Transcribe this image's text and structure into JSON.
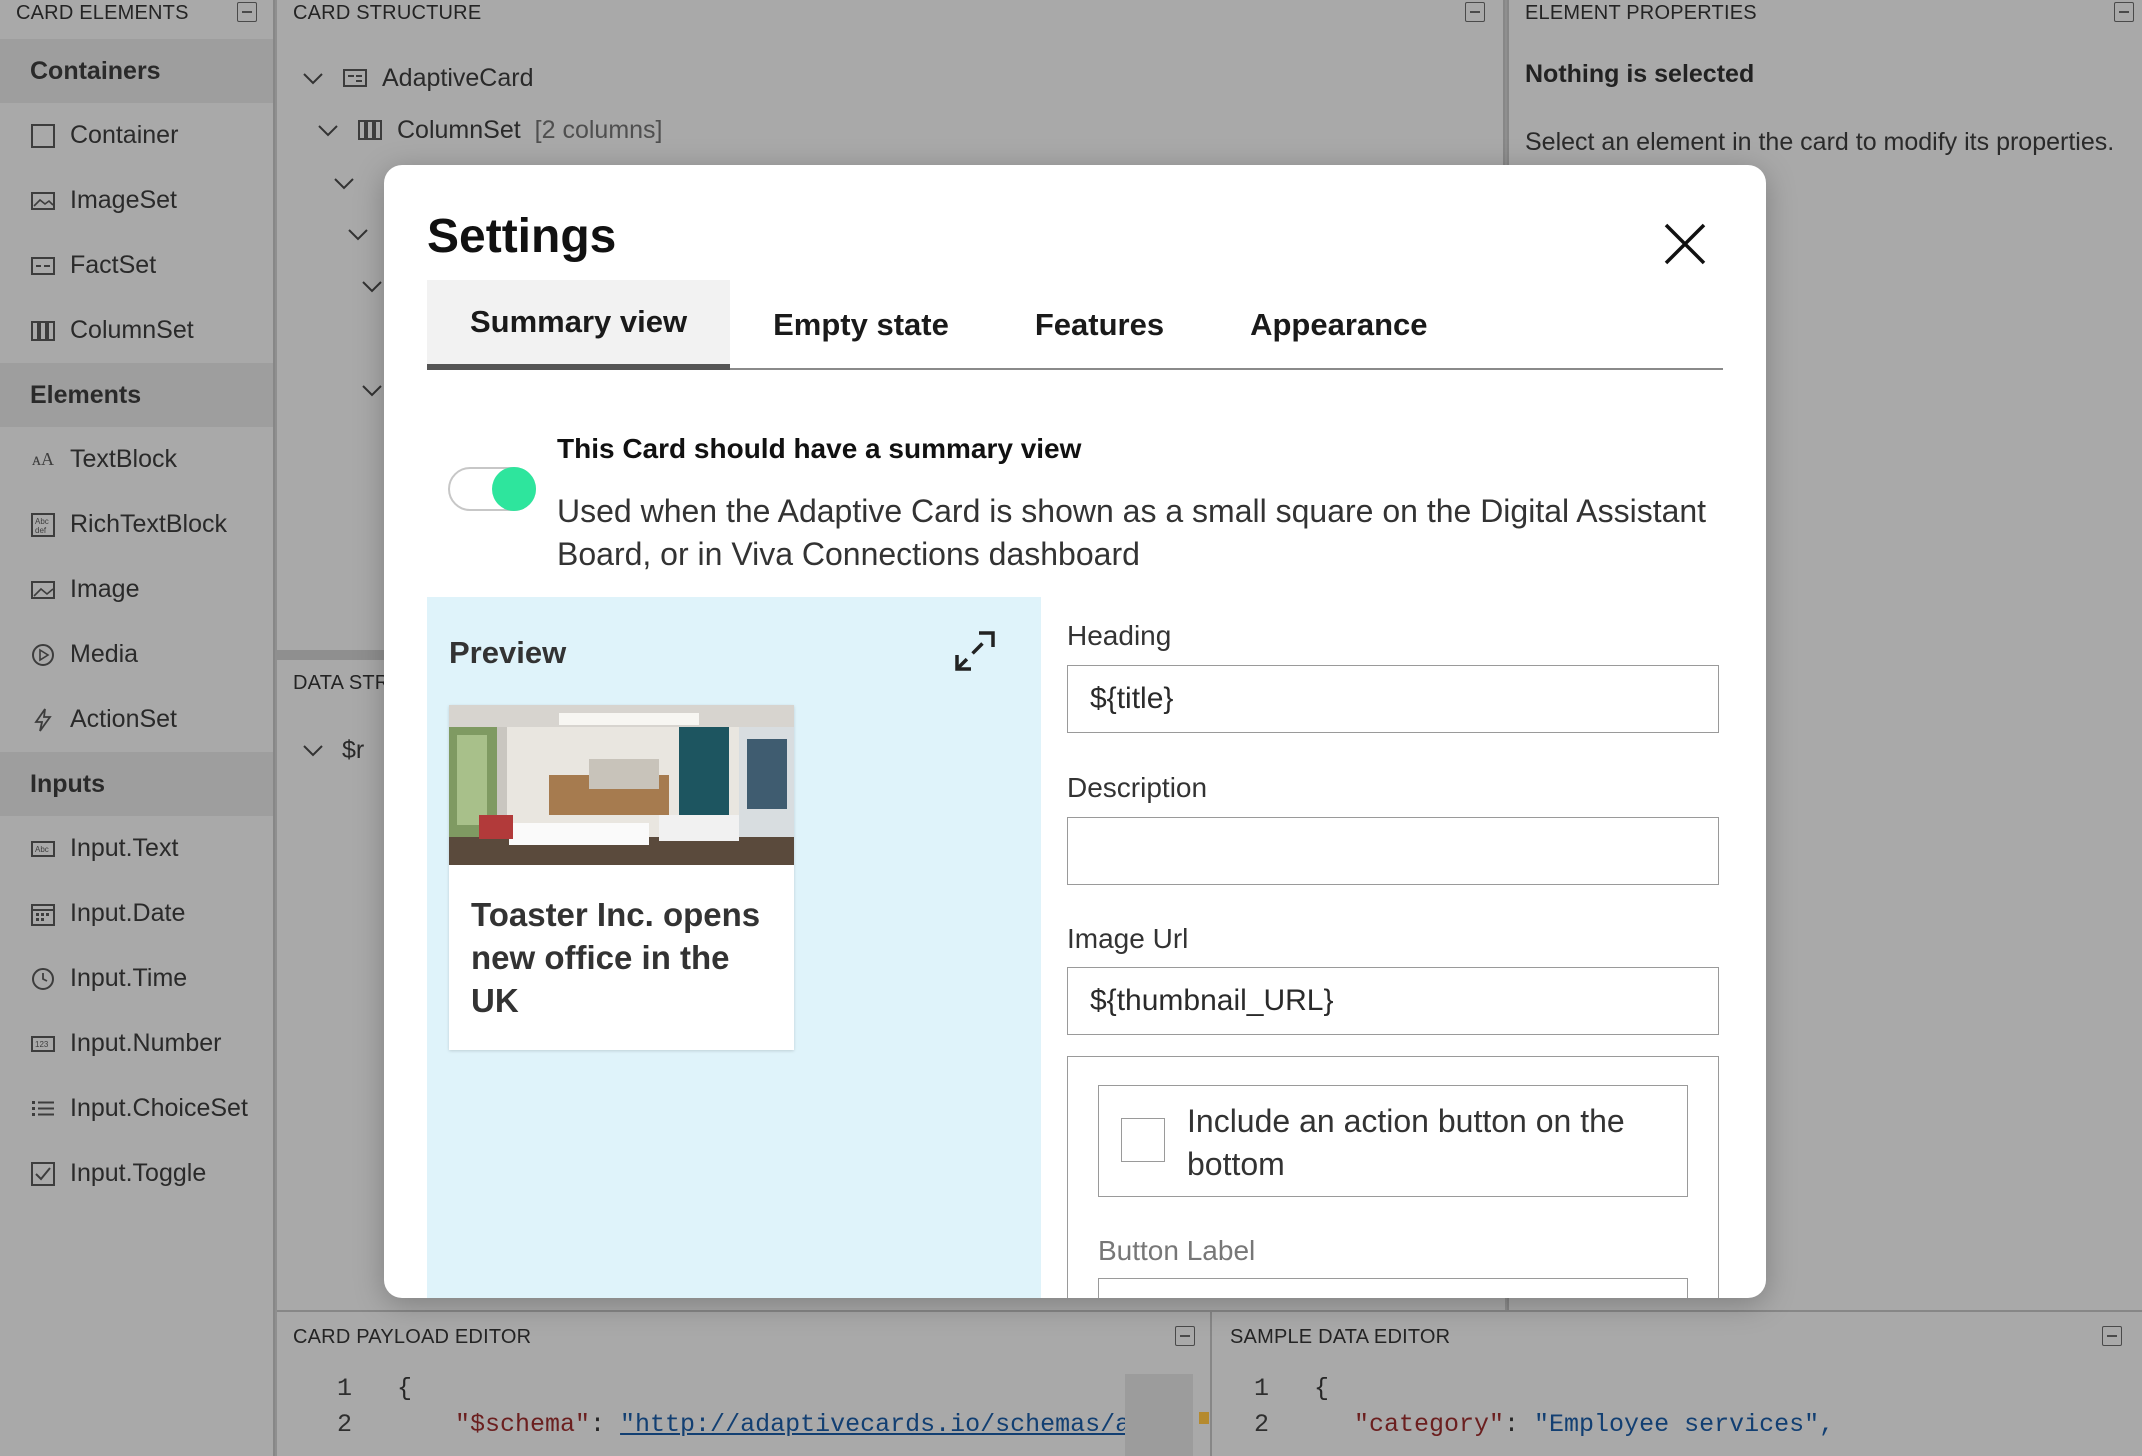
{
  "panels": {
    "card_elements": "CARD ELEMENTS",
    "card_structure": "CARD STRUCTURE",
    "element_properties": "ELEMENT PROPERTIES",
    "data_structure": "DATA STR",
    "card_payload_editor": "CARD PAYLOAD EDITOR",
    "sample_data_editor": "SAMPLE DATA EDITOR"
  },
  "toolbox": {
    "groups": [
      {
        "label": "Containers",
        "items": [
          "Container",
          "ImageSet",
          "FactSet",
          "ColumnSet"
        ]
      },
      {
        "label": "Elements",
        "items": [
          "TextBlock",
          "RichTextBlock",
          "Image",
          "Media",
          "ActionSet"
        ]
      },
      {
        "label": "Inputs",
        "items": [
          "Input.Text",
          "Input.Date",
          "Input.Time",
          "Input.Number",
          "Input.ChoiceSet",
          "Input.Toggle"
        ]
      }
    ]
  },
  "structure": {
    "root": "AdaptiveCard",
    "columnset": "ColumnSet",
    "columnset_meta": "[2 columns]",
    "data_root": "$r"
  },
  "properties": {
    "title": "Nothing is selected",
    "text": "Select an element in the card to modify its properties."
  },
  "payload_editor": {
    "line_numbers": [
      "1",
      "2"
    ],
    "line1": "{",
    "line2_key": "\"$schema\"",
    "line2_colon": ": ",
    "line2_value": "\"http://adaptivecards.io/schemas/ad"
  },
  "sample_editor": {
    "line_numbers": [
      "1",
      "2"
    ],
    "line1": "{",
    "line2_key": "\"category\"",
    "line2_colon": ": ",
    "line2_value": "\"Employee services\","
  },
  "modal": {
    "title": "Settings",
    "tabs": [
      "Summary view",
      "Empty state",
      "Features",
      "Appearance"
    ],
    "active_tab": "Summary view",
    "summary_toggle_on": true,
    "summary_heading": "This Card should have a summary view",
    "summary_description": "Used when the Adaptive Card is shown as a small square on the Digital Assistant Board, or in Viva Connections dashboard",
    "preview": {
      "label": "Preview",
      "card_title": "Toaster Inc. opens new office in the UK"
    },
    "fields": {
      "heading_label": "Heading",
      "heading_value": "${title}",
      "description_label": "Description",
      "description_value": "",
      "image_url_label": "Image Url",
      "image_url_value": "${thumbnail_URL}",
      "action_checkbox_label": "Include an action button on the bottom",
      "action_checked": false,
      "button_label_label": "Button Label"
    }
  },
  "colors": {
    "toggle_on": "#2ee59d",
    "preview_bg": "#dff3fa",
    "overlay_bg": "#a9a9a9"
  }
}
